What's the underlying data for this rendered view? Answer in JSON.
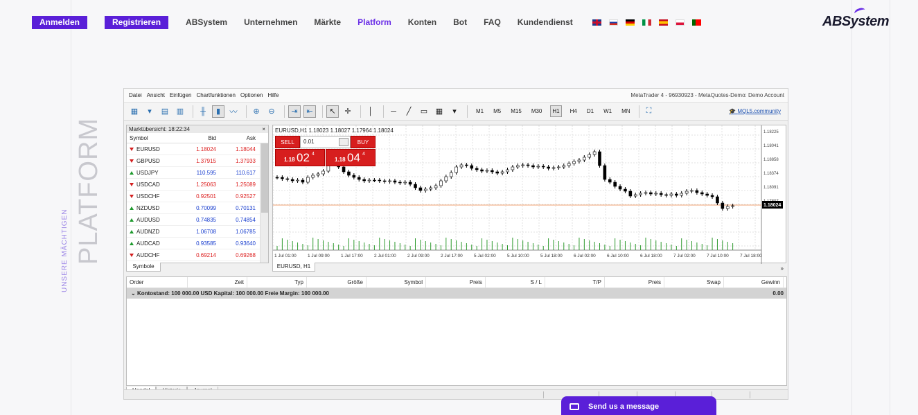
{
  "nav": {
    "login": "Anmelden",
    "register": "Registrieren",
    "links": [
      "ABSystem",
      "Unternehmen",
      "Märkte",
      "Platform",
      "Konten",
      "Bot",
      "FAQ",
      "Kundendienst"
    ],
    "active": "Platform",
    "flags": [
      "en-flag-icon",
      "ru-flag-icon",
      "de-flag-icon",
      "it-flag-icon",
      "es-flag-icon",
      "pl-flag-icon",
      "pt-flag-icon"
    ]
  },
  "logo": "ABSystem",
  "side": {
    "big": "PLATFORM",
    "small": "UNSERE MÄCHTIGEN"
  },
  "mt4": {
    "menu": [
      "Datei",
      "Ansicht",
      "Einfügen",
      "Chartfunktionen",
      "Optionen",
      "Hilfe"
    ],
    "account": "MetaTrader 4 - 96930923 - MetaQuotes-Demo: Demo Account",
    "timeframes": [
      "M1",
      "M5",
      "M15",
      "M30",
      "H1",
      "H4",
      "D1",
      "W1",
      "MN"
    ],
    "selected_tf": "H1",
    "community": "MQL5.community",
    "market_watch": {
      "title": "Marktübersicht: 18:22:34",
      "close": "×",
      "headers": [
        "Symbol",
        "Bid",
        "Ask"
      ],
      "rows": [
        {
          "symbol": "EURUSD",
          "bid": "1.18024",
          "ask": "1.18044",
          "dir": "down",
          "color": "red"
        },
        {
          "symbol": "GBPUSD",
          "bid": "1.37915",
          "ask": "1.37933",
          "dir": "down",
          "color": "red"
        },
        {
          "symbol": "USDJPY",
          "bid": "110.595",
          "ask": "110.617",
          "dir": "up",
          "color": "blue"
        },
        {
          "symbol": "USDCAD",
          "bid": "1.25063",
          "ask": "1.25089",
          "dir": "down",
          "color": "red"
        },
        {
          "symbol": "USDCHF",
          "bid": "0.92501",
          "ask": "0.92527",
          "dir": "down",
          "color": "red"
        },
        {
          "symbol": "NZDUSD",
          "bid": "0.70099",
          "ask": "0.70131",
          "dir": "up",
          "color": "blue"
        },
        {
          "symbol": "AUDUSD",
          "bid": "0.74835",
          "ask": "0.74854",
          "dir": "up",
          "color": "blue"
        },
        {
          "symbol": "AUDNZD",
          "bid": "1.06708",
          "ask": "1.06785",
          "dir": "up",
          "color": "blue"
        },
        {
          "symbol": "AUDCAD",
          "bid": "0.93585",
          "ask": "0.93640",
          "dir": "up",
          "color": "blue"
        },
        {
          "symbol": "AUDCHF",
          "bid": "0.69214",
          "ask": "0.69268",
          "dir": "down",
          "color": "red"
        }
      ],
      "tab": "Symbole"
    },
    "chart": {
      "header": "EURUSD,H1  1.18023 1.18027 1.17964 1.18024",
      "sell": "SELL",
      "buy": "BUY",
      "lot": "0.01",
      "sell_price": {
        "prefix": "1.18",
        "big": "02",
        "sup": "4"
      },
      "buy_price": {
        "prefix": "1.18",
        "big": "04",
        "sup": "4"
      },
      "current_price": "1.18024",
      "price_labels": [
        "1.18225",
        "1.18041",
        "1.18858",
        "1.18374",
        "1.18091",
        "1.17807"
      ],
      "time_labels": [
        "1 Jul 01:00",
        "1 Jul 09:00",
        "1 Jul 17:00",
        "2 Jul 01:00",
        "2 Jul 09:00",
        "2 Jul 17:00",
        "5 Jul 02:00",
        "5 Jul 10:00",
        "5 Jul 18:00",
        "6 Jul 02:00",
        "6 Jul 10:00",
        "6 Jul 18:00",
        "7 Jul 02:00",
        "7 Jul 10:00",
        "7 Jul 18:00"
      ],
      "tab": "EURUSD, H1",
      "more": "»"
    },
    "terminal": {
      "headers": [
        "Order",
        "Zeit",
        "Typ",
        "Größe",
        "Symbol",
        "Preis",
        "S / L",
        "T/P",
        "Preis",
        "Swap",
        "Gewinn"
      ],
      "balance": "Kontostand: 100 000.00 USD  Kapital: 100 000.00  Freie Margin: 100 000.00",
      "total": "0.00",
      "tabs": [
        "Handel",
        "Historie",
        "Journal"
      ]
    }
  },
  "chat": "Send us a message"
}
